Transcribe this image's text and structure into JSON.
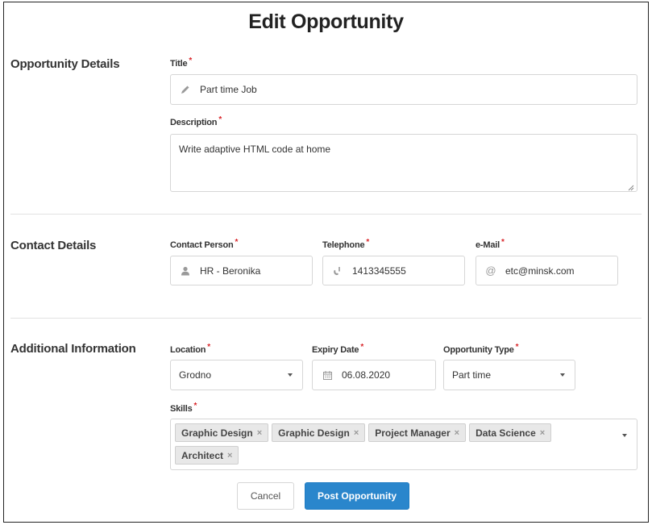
{
  "page": {
    "title": "Edit Opportunity"
  },
  "sections": {
    "opportunity": {
      "title": "Opportunity Details"
    },
    "contact": {
      "title": "Contact Details"
    },
    "additional": {
      "title": "Additional Information"
    }
  },
  "fields": {
    "title": {
      "label": "Title",
      "value": "Part time Job",
      "icon": "pencil-icon"
    },
    "description": {
      "label": "Description",
      "value": "Write adaptive HTML code at home"
    },
    "contact_person": {
      "label": "Contact Person",
      "value": "HR - Beronika",
      "icon": "person-icon"
    },
    "telephone": {
      "label": "Telephone",
      "value": "1413345555",
      "icon": "phone-icon"
    },
    "email": {
      "label": "e-Mail",
      "value": "etc@minsk.com",
      "icon": "at-icon"
    },
    "location": {
      "label": "Location",
      "value": "Grodno"
    },
    "expiry_date": {
      "label": "Expiry Date",
      "value": "06.08.2020",
      "icon": "calendar-icon"
    },
    "opportunity_type": {
      "label": "Opportunity Type",
      "value": "Part time"
    },
    "skills": {
      "label": "Skills",
      "tags": [
        "Graphic Design",
        "Graphic Design",
        "Project Manager",
        "Data Science",
        "Architect"
      ],
      "remove_glyph": "×"
    }
  },
  "required_marker": "*",
  "buttons": {
    "cancel": "Cancel",
    "submit": "Post Opportunity"
  },
  "colors": {
    "primary": "#2a86cc",
    "required": "#d9262a"
  }
}
